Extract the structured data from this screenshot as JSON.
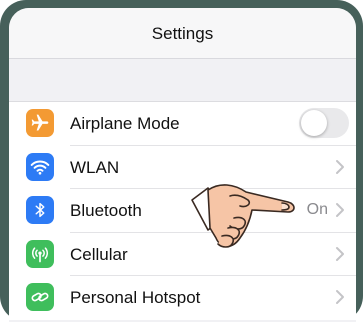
{
  "header": {
    "title": "Settings"
  },
  "settings": {
    "items": [
      {
        "label": "Airplane Mode",
        "icon": "airplane-icon",
        "color": "#F39A33",
        "control": "toggle",
        "toggle_on": false
      },
      {
        "label": "WLAN",
        "icon": "wifi-icon",
        "color": "#2D7BF5",
        "control": "chevron"
      },
      {
        "label": "Bluetooth",
        "icon": "bluetooth-icon",
        "color": "#2D7BF5",
        "control": "chevron",
        "value": "On"
      },
      {
        "label": "Cellular",
        "icon": "cellular-icon",
        "color": "#3FBE5C",
        "control": "chevron"
      },
      {
        "label": "Personal Hotspot",
        "icon": "hotspot-icon",
        "color": "#3FBE5C",
        "control": "chevron"
      }
    ]
  },
  "overlay": {
    "icon": "pointing-hand-icon"
  }
}
